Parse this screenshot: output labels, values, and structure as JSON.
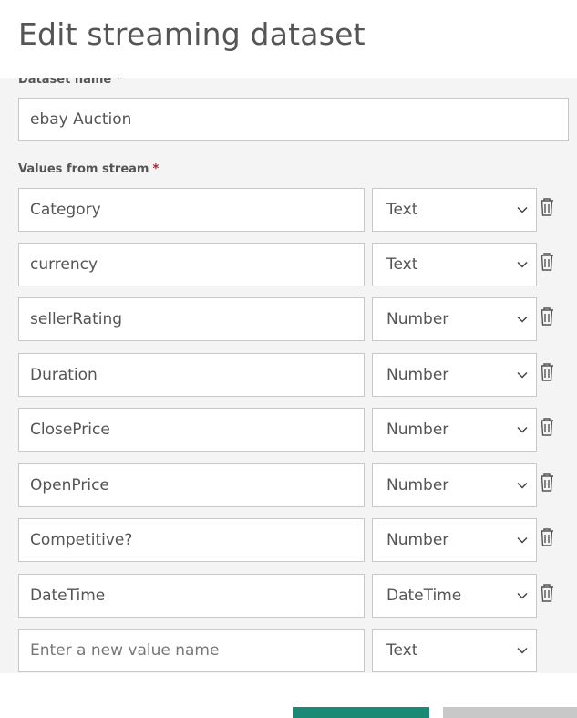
{
  "header": {
    "title": "Edit streaming dataset"
  },
  "form": {
    "dataset_name_label": "Dataset name",
    "dataset_name_required": "*",
    "dataset_name_value": "ebay Auction",
    "values_label": "Values from stream",
    "values_required": "*",
    "rows": [
      {
        "name": "Category",
        "type": "Text"
      },
      {
        "name": "currency",
        "type": "Text"
      },
      {
        "name": "sellerRating",
        "type": "Number"
      },
      {
        "name": "Duration",
        "type": "Number"
      },
      {
        "name": "ClosePrice",
        "type": "Number"
      },
      {
        "name": "OpenPrice",
        "type": "Number"
      },
      {
        "name": "Competitive?",
        "type": "Number"
      },
      {
        "name": "DateTime",
        "type": "DateTime"
      }
    ],
    "new_row": {
      "placeholder": "Enter a new value name",
      "type": "Text"
    }
  },
  "colors": {
    "primary": "#1a8a74",
    "secondary": "#c8c8c8",
    "required": "#a4262c"
  },
  "icons": {
    "delete": "trash-icon",
    "dropdown": "chevron-down-icon"
  }
}
